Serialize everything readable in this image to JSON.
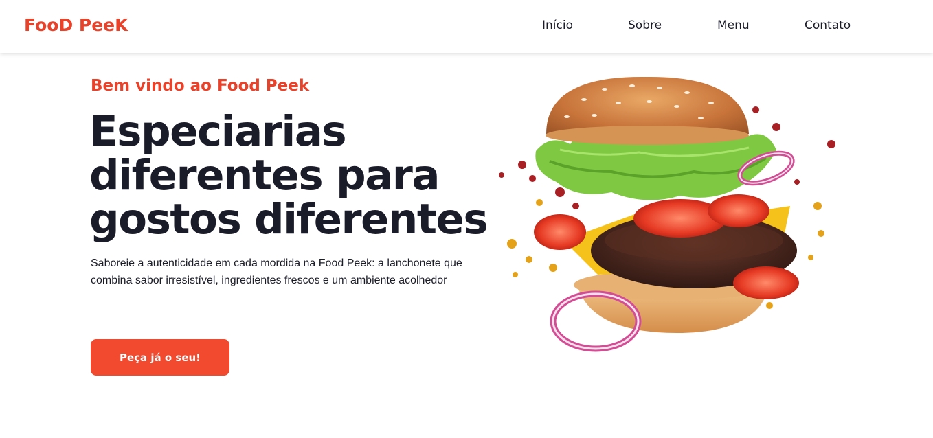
{
  "header": {
    "logo": {
      "part1": "F",
      "part2": "oo",
      "part3": "D P",
      "part4": "ee",
      "part5": "K"
    },
    "nav": [
      "Início",
      "Sobre",
      "Menu",
      "Contato"
    ]
  },
  "hero": {
    "eyebrow": "Bem vindo ao Food Peek",
    "headline_line1": "Especiarias",
    "headline_line2": "diferentes para",
    "headline_line3": "gostos diferentes",
    "description": "Saboreie a autenticidade em cada mordida na Food Peek: a lanchonete que combina sabor irresistível, ingredientes frescos e um ambiente acolhedor",
    "cta_label": "Peça já o seu!"
  },
  "colors": {
    "accent": "#f24a2e",
    "text": "#1b1c29"
  },
  "image": {
    "subject": "burger-illustration"
  }
}
